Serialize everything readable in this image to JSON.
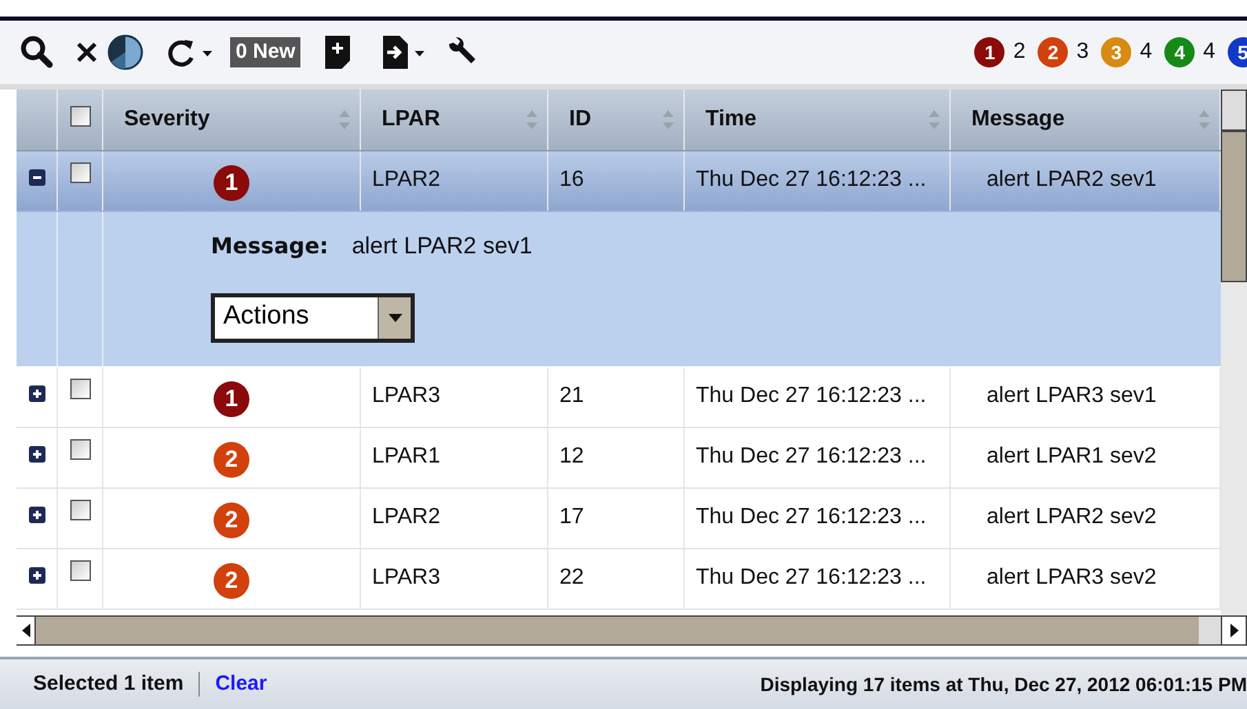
{
  "toolbar": {
    "new_count": "0 New",
    "severity_counts": [
      {
        "label": "1",
        "color": "#8b0a0a",
        "count": "2"
      },
      {
        "label": "2",
        "color": "#d2400c",
        "count": "3"
      },
      {
        "label": "3",
        "color": "#d98a10",
        "count": "4"
      },
      {
        "label": "4",
        "color": "#168a16",
        "count": "4"
      },
      {
        "label": "5",
        "color": "#1238c8"
      }
    ]
  },
  "table": {
    "select_all_checked": false,
    "columns": [
      "Severity",
      "LPAR",
      "ID",
      "Time",
      "Message"
    ],
    "rows": [
      {
        "severity": "1",
        "color": "#8b0a0a",
        "lpar": "LPAR2",
        "id": "16",
        "time": "Thu Dec 27 16:12:23 ...",
        "message": "alert LPAR2 sev1",
        "expanded": true,
        "selected": true,
        "checked": false,
        "detail": {
          "label": "Message:",
          "value": "alert LPAR2 sev1",
          "action": "Actions"
        }
      },
      {
        "severity": "1",
        "color": "#8b0a0a",
        "lpar": "LPAR3",
        "id": "21",
        "time": "Thu Dec 27 16:12:23 ...",
        "message": "alert LPAR3 sev1",
        "expanded": false,
        "selected": false,
        "checked": false
      },
      {
        "severity": "2",
        "color": "#d2400c",
        "lpar": "LPAR1",
        "id": "12",
        "time": "Thu Dec 27 16:12:23 ...",
        "message": "alert LPAR1 sev2",
        "expanded": false,
        "selected": false,
        "checked": false
      },
      {
        "severity": "2",
        "color": "#d2400c",
        "lpar": "LPAR2",
        "id": "17",
        "time": "Thu Dec 27 16:12:23 ...",
        "message": "alert LPAR2 sev2",
        "expanded": false,
        "selected": false,
        "checked": false
      },
      {
        "severity": "2",
        "color": "#d2400c",
        "lpar": "LPAR3",
        "id": "22",
        "time": "Thu Dec 27 16:12:23 ...",
        "message": "alert LPAR3 sev2",
        "expanded": false,
        "selected": false,
        "checked": false
      }
    ]
  },
  "status_bar": {
    "selection": "Selected 1 item",
    "clear": "Clear",
    "info": "Displaying 17 items at Thu, Dec 27, 2012 06:01:15 PM"
  }
}
